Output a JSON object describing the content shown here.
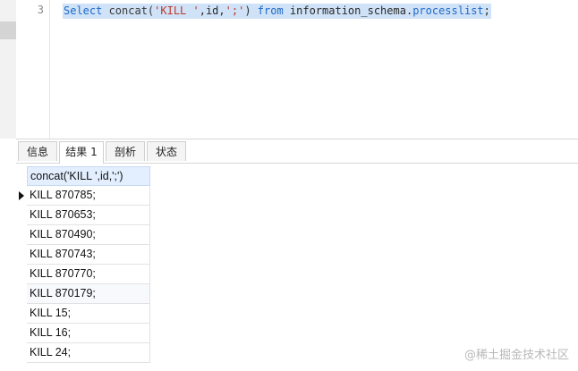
{
  "editor": {
    "line_number": "3",
    "tokens": {
      "select": "Select",
      "concat": " concat(",
      "kill_str": "'KILL '",
      "id_part": ",id,",
      "semi_str": "';'",
      "close": ") ",
      "from": "from",
      "schema": " information_schema.",
      "table": "processlist",
      "end": ";"
    }
  },
  "tabs": [
    {
      "label": "信息"
    },
    {
      "label": "结果 1"
    },
    {
      "label": "剖析"
    },
    {
      "label": "状态"
    }
  ],
  "result": {
    "column_header": "concat('KILL ',id,';')",
    "rows": [
      "KILL 870785;",
      "KILL 870653;",
      "KILL 870490;",
      "KILL 870743;",
      "KILL 870770;",
      "KILL 870179;",
      "KILL 15;",
      "KILL 16;",
      "KILL 24;"
    ]
  },
  "watermark": "@稀土掘金技术社区",
  "colors": {
    "selection": "#cfe2f7",
    "keyword": "#1e6ac9",
    "string": "#c0392b",
    "header_bg": "#e3efff"
  }
}
